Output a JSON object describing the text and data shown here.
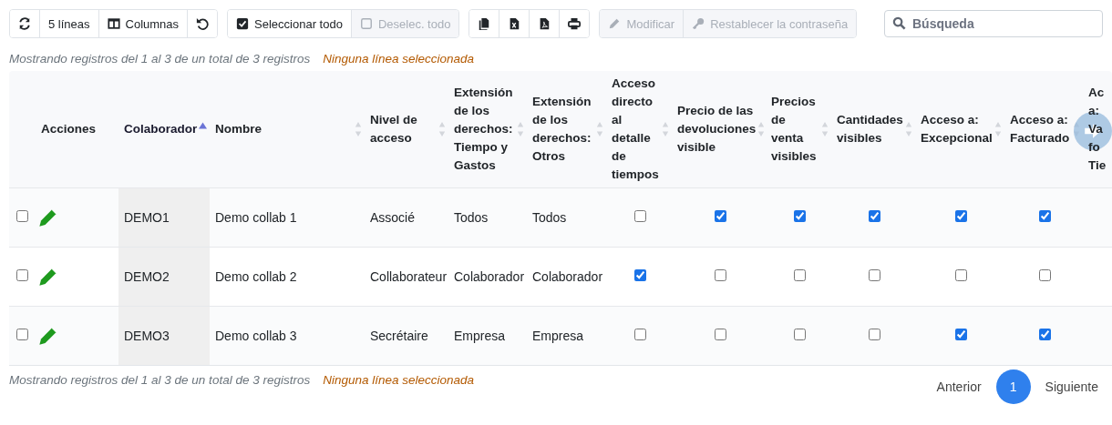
{
  "toolbar": [
    {
      "buttons": [
        {
          "kind": "refresh",
          "disabled": false
        },
        {
          "kind": "text",
          "label": "5 líneas",
          "disabled": false
        },
        {
          "kind": "columns",
          "label": "Columnas",
          "disabled": false
        },
        {
          "kind": "undo",
          "disabled": false
        }
      ]
    },
    {
      "buttons": [
        {
          "kind": "checkall",
          "label": "Seleccionar todo",
          "disabled": false
        },
        {
          "kind": "uncheckall",
          "label": "Deselec. todo",
          "disabled": true
        }
      ]
    },
    {
      "buttons": [
        {
          "kind": "copy",
          "disabled": false
        },
        {
          "kind": "excel",
          "disabled": false
        },
        {
          "kind": "pdf",
          "disabled": false
        },
        {
          "kind": "print",
          "disabled": false
        }
      ]
    },
    {
      "buttons": [
        {
          "kind": "pencil",
          "label": "Modificar",
          "disabled": true
        },
        {
          "kind": "key",
          "label": "Restablecer la contraseña",
          "disabled": true
        }
      ]
    }
  ],
  "search": {
    "placeholder": "Búsqueda"
  },
  "info_top": {
    "text": "Mostrando registros del 1 al 3 de un total de 3 registros",
    "selection": "Ninguna línea seleccionada"
  },
  "table": {
    "columns": [
      {
        "kind": "select"
      },
      {
        "kind": "actions",
        "label": "Acciones"
      },
      {
        "kind": "text",
        "label": "Colaborador",
        "sortable": true,
        "sorted": true
      },
      {
        "kind": "text",
        "label": "Nombre",
        "sortable": true,
        "sorted": false
      },
      {
        "kind": "text",
        "label": "Nivel de acceso",
        "sortable": true,
        "sorted": false
      },
      {
        "kind": "text",
        "label": "Extensión de los derechos: Tiempo y Gastos",
        "sortable": true,
        "sorted": false
      },
      {
        "kind": "text",
        "label": "Extensión de los derechos: Otros",
        "sortable": true,
        "sorted": false
      },
      {
        "kind": "check",
        "label": "Acceso directo al detalle de tiempos",
        "sortable": true,
        "sorted": false
      },
      {
        "kind": "check",
        "label": "Precio de las devoluciones visible",
        "sortable": true,
        "sorted": false
      },
      {
        "kind": "check",
        "label": "Precios de venta visibles",
        "sortable": true,
        "sorted": false
      },
      {
        "kind": "check",
        "label": "Cantidades visibles",
        "sortable": true,
        "sorted": false
      },
      {
        "kind": "check",
        "label": "Acceso a: Excepcional",
        "sortable": true,
        "sorted": false
      },
      {
        "kind": "check",
        "label": "Acceso a: Facturado",
        "sortable": true,
        "sorted": false
      },
      {
        "kind": "check",
        "label": "Ac\na:\nVa\nfo\nTie"
      }
    ],
    "rows": [
      {
        "selected": false,
        "cells": [
          null,
          null,
          "DEMO1",
          "Demo collab 1",
          "Associé",
          "Todos",
          "Todos",
          false,
          true,
          true,
          true,
          true,
          true,
          null
        ]
      },
      {
        "selected": false,
        "cells": [
          null,
          null,
          "DEMO2",
          "Demo collab 2",
          "Collaborateur",
          "Colaborador",
          "Colaborador",
          true,
          false,
          false,
          false,
          false,
          false,
          null
        ]
      },
      {
        "selected": false,
        "cells": [
          null,
          null,
          "DEMO3",
          "Demo collab 3",
          "Secrétaire",
          "Empresa",
          "Empresa",
          false,
          false,
          false,
          false,
          true,
          true,
          null
        ]
      }
    ]
  },
  "info_bottom": {
    "text": "Mostrando registros del 1 al 3 de un total de 3 registros",
    "selection": "Ninguna línea seleccionada"
  },
  "pagination": {
    "previous": "Anterior",
    "pages": [
      {
        "label": "1",
        "selected": true
      }
    ],
    "next": "Siguiente"
  }
}
